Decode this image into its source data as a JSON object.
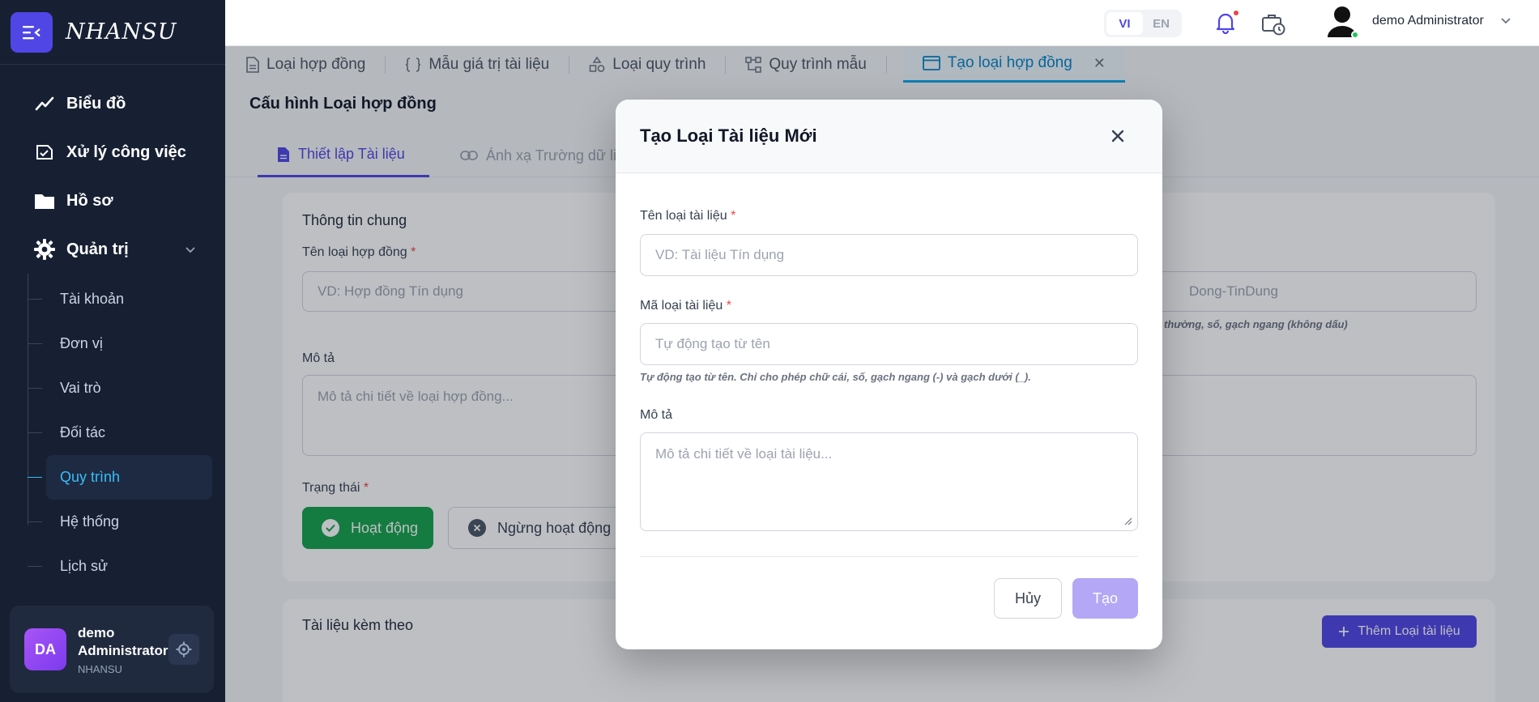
{
  "sidebar": {
    "brand": "NHANSU",
    "nav": [
      {
        "label": "Biểu đồ",
        "icon": "trend-chart-icon"
      },
      {
        "label": "Xử lý công việc",
        "icon": "task-process-icon"
      },
      {
        "label": "Hồ sơ",
        "icon": "folder-icon"
      },
      {
        "label": "Quản trị",
        "icon": "gear-icon"
      }
    ],
    "sub_items": [
      "Tài khoản",
      "Đơn vị",
      "Vai trò",
      "Đối tác",
      "Quy trình",
      "Hệ thống",
      "Lịch sử"
    ],
    "active_sub": "Quy trình",
    "user": {
      "initials": "DA",
      "name": "demo Administrator",
      "org": "NHANSU"
    }
  },
  "header": {
    "lang_vi": "VI",
    "lang_en": "EN",
    "user_name": "demo Administrator"
  },
  "page_tabs": [
    {
      "label": "Loại hợp đồng",
      "icon": "document-icon"
    },
    {
      "label": "Mẫu giá trị tài liệu",
      "icon": "braces-icon"
    },
    {
      "label": "Loại quy trình",
      "icon": "shapes-icon"
    },
    {
      "label": "Quy trình mẫu",
      "icon": "workflow-icon"
    },
    {
      "label": "Tạo loại hợp đồng",
      "icon": "window-icon",
      "active": true,
      "close": "✕"
    }
  ],
  "page_title": "Cấu hình Loại hợp đồng",
  "sub_tabs": [
    {
      "label": "Thiết lập Tài liệu",
      "active": true
    },
    {
      "label": "Ánh xạ Trường dữ liệu",
      "active": false
    }
  ],
  "form": {
    "section_general": "Thông tin chung",
    "name_label": "Tên loại hợp đồng",
    "name_placeholder": "VD: Hợp đồng Tín dụng",
    "code_placeholder_visible": "Dong-TinDung",
    "code_hint_visible": "thường, số, gạch ngang (không dấu)",
    "desc_label": "Mô tả",
    "desc_placeholder": "Mô tả chi tiết về loại hợp đồng...",
    "status_label": "Trạng thái",
    "status_active": "Hoạt động",
    "status_inactive": "Ngừng hoạt động",
    "attachments_label": "Tài liệu kèm theo",
    "add_doc_button": "Thêm Loại tài liệu"
  },
  "modal": {
    "title": "Tạo Loại Tài liệu Mới",
    "name_label": "Tên loại tài liệu",
    "name_placeholder": "VD: Tài liệu Tín dụng",
    "code_label": "Mã loại tài liệu",
    "code_placeholder": "Tự động tạo từ tên",
    "code_hint": "Tự động tạo từ tên. Chỉ cho phép chữ cái, số, gạch ngang (-) và gạch dưới (_).",
    "desc_label": "Mô tả",
    "desc_placeholder": "Mô tả chi tiết về loại tài liệu...",
    "cancel": "Hủy",
    "create": "Tạo",
    "required_mark": "*"
  },
  "colors": {
    "sidebar_bg": "#172033",
    "primary": "#4f46e5",
    "active_link": "#38bdf8",
    "success": "#16a34a",
    "create_disabled": "#b4a7f5"
  }
}
